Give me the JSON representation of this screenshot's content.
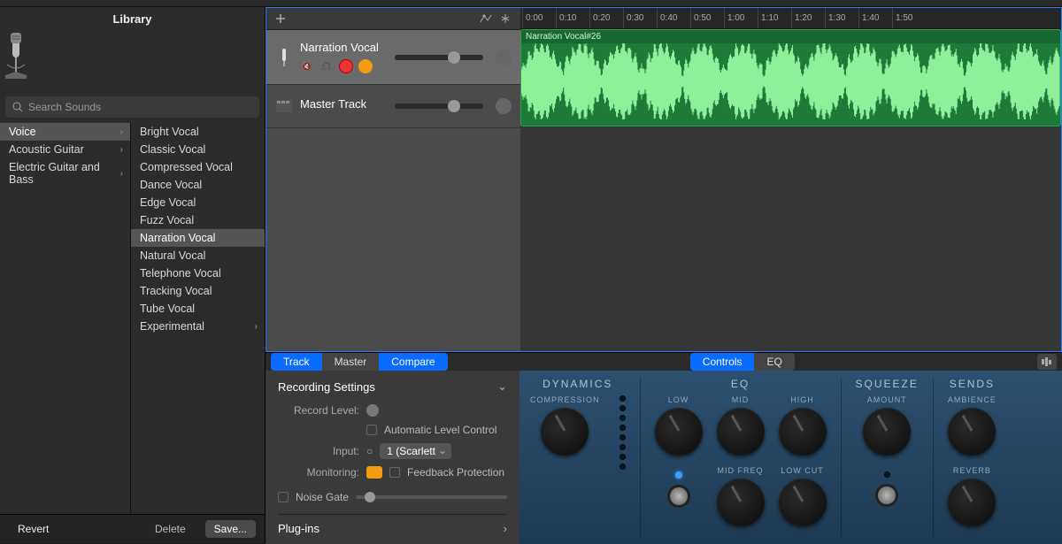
{
  "library": {
    "title": "Library",
    "search_placeholder": "Search Sounds",
    "categories": [
      {
        "label": "Voice",
        "selected": true,
        "chevron": true
      },
      {
        "label": "Acoustic Guitar",
        "selected": false,
        "chevron": true
      },
      {
        "label": "Electric Guitar and Bass",
        "selected": false,
        "chevron": true
      }
    ],
    "presets": [
      {
        "label": "Bright Vocal",
        "selected": false
      },
      {
        "label": "Classic Vocal",
        "selected": false
      },
      {
        "label": "Compressed Vocal",
        "selected": false
      },
      {
        "label": "Dance Vocal",
        "selected": false
      },
      {
        "label": "Edge Vocal",
        "selected": false
      },
      {
        "label": "Fuzz Vocal",
        "selected": false
      },
      {
        "label": "Narration Vocal",
        "selected": true
      },
      {
        "label": "Natural Vocal",
        "selected": false
      },
      {
        "label": "Telephone Vocal",
        "selected": false
      },
      {
        "label": "Tracking Vocal",
        "selected": false
      },
      {
        "label": "Tube Vocal",
        "selected": false
      },
      {
        "label": "Experimental",
        "selected": false,
        "chevron": true
      }
    ],
    "footer": {
      "revert": "Revert",
      "delete": "Delete",
      "save": "Save..."
    }
  },
  "ruler": [
    "0:00",
    "0:10",
    "0:20",
    "0:30",
    "0:40",
    "0:50",
    "1:00",
    "1:10",
    "1:20",
    "1:30",
    "1:40",
    "1:50"
  ],
  "tracks": [
    {
      "name": "Narration Vocal",
      "selected": true,
      "has_controls": true
    },
    {
      "name": "Master Track",
      "selected": false,
      "has_controls": false
    }
  ],
  "clip": {
    "title": "Narration Vocal#26"
  },
  "editor": {
    "tabs_left": [
      {
        "label": "Track",
        "active": true
      },
      {
        "label": "Master",
        "active": false
      },
      {
        "label": "Compare",
        "active": true
      }
    ],
    "tabs_center": [
      {
        "label": "Controls",
        "active": true
      },
      {
        "label": "EQ",
        "active": false
      }
    ],
    "settings": {
      "title": "Recording Settings",
      "record_level": "Record Level:",
      "alc": "Automatic Level Control",
      "input_label": "Input:",
      "input_value": "1  (Scarlett",
      "monitoring": "Monitoring:",
      "feedback": "Feedback Protection",
      "noise_gate": "Noise Gate",
      "plugins": "Plug-ins"
    },
    "eq": {
      "dynamics": "DYNAMICS",
      "compression": "COMPRESSION",
      "eq": "EQ",
      "low": "LOW",
      "mid": "MID",
      "high": "HIGH",
      "mid_freq": "MID FREQ",
      "low_cut": "LOW CUT",
      "squeeze": "SQUEEZE",
      "amount": "AMOUNT",
      "sends": "SENDS",
      "ambience": "AMBIENCE",
      "reverb": "REVERB"
    }
  }
}
